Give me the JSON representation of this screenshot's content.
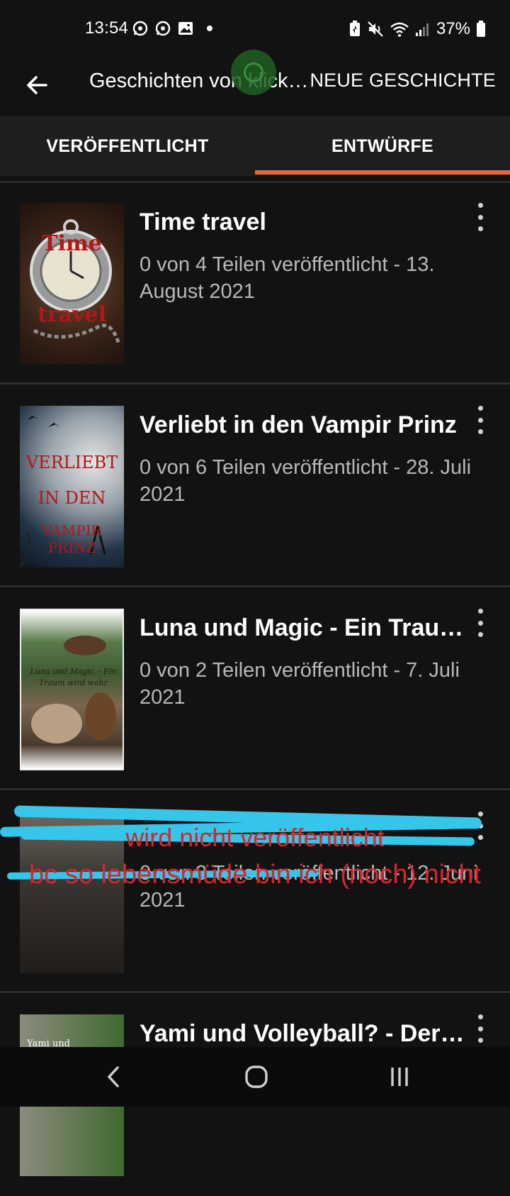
{
  "status_bar": {
    "time": "13:54",
    "battery": "37%",
    "icons_left": [
      "whatsapp-icon",
      "whatsapp-icon",
      "gallery-icon",
      "dot"
    ],
    "icons_right": [
      "battery-saver-icon",
      "mute-icon",
      "wifi-icon",
      "signal-icon",
      "battery-icon"
    ]
  },
  "app_bar": {
    "title": "Geschichten von klick…",
    "action": "NEUE GESCHICHTE"
  },
  "tabs": [
    {
      "label": "VERÖFFENTLICHT",
      "active": false
    },
    {
      "label": "ENTWÜRFE",
      "active": true
    }
  ],
  "accent_color": "#e5673c",
  "stories": [
    {
      "title": "Time travel",
      "meta": "0 von 4 Teilen veröffentlicht - 13. August 2021",
      "cover_text": [
        "Time",
        "travel"
      ]
    },
    {
      "title": "Verliebt in den Vampir Prinz",
      "meta": "0 von 6 Teilen veröffentlicht - 28. Juli 2021",
      "cover_text": [
        "VERLIEBT",
        "IN DEN",
        "VAMPIR PRINZ"
      ]
    },
    {
      "title": "Luna und Magic - Ein Trau…",
      "meta": "0 von 2 Teilen veröffentlicht - 7. Juli 2021",
      "cover_text": [
        "Luna und Magic – Ein",
        "Traum wird wahr"
      ]
    },
    {
      "title": "",
      "meta": "0 von 3 Teilen veröffentlicht - 12. Juni 2021",
      "overlay_line1": "wird nicht veröffentlicht",
      "overlay_line2": "bc so lebensmüde bin ich (noch) nicht"
    },
    {
      "title": "Yami und Volleyball? - Der…",
      "meta": "",
      "cover_text": [
        "Yami und"
      ]
    }
  ]
}
